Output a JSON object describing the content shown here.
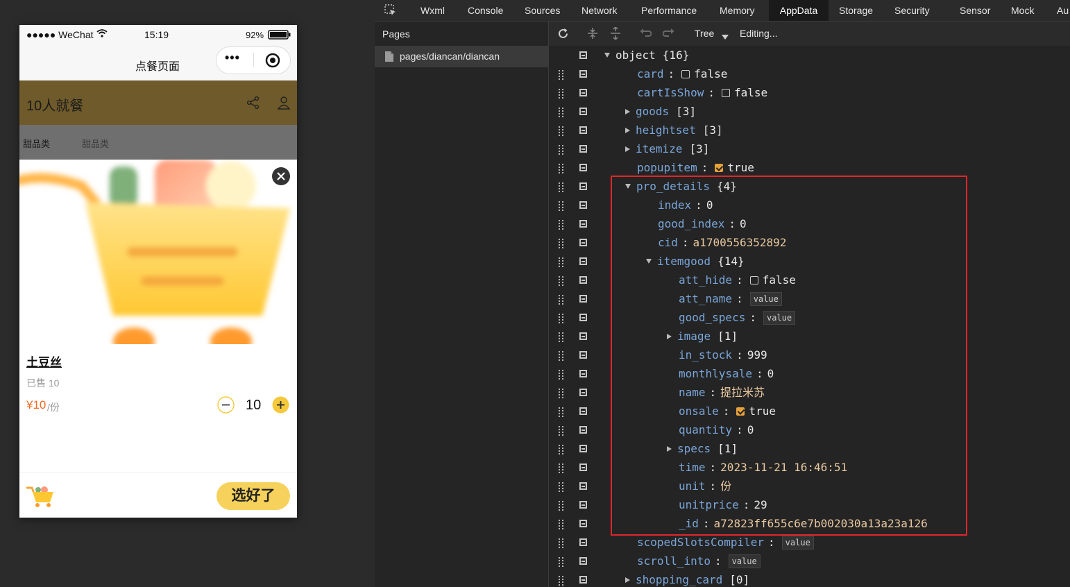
{
  "phone": {
    "status": {
      "carrier": "●●●●● WeChat",
      "time": "15:19",
      "battery": "92%"
    },
    "nav": {
      "title": "点餐页面",
      "more": "•••"
    },
    "shop": {
      "title": "10人就餐"
    },
    "categories": [
      "甜品类",
      "甜品类"
    ],
    "product": {
      "name": "土豆丝",
      "sold": "已售 10",
      "price": "¥10",
      "unit": "/份",
      "quantity": "10"
    },
    "cart": {
      "confirm_label": "选好了"
    }
  },
  "devtools": {
    "tabs": [
      "Wxml",
      "Console",
      "Sources",
      "Network",
      "Performance",
      "Memory",
      "AppData",
      "Storage",
      "Security",
      "Sensor",
      "Mock",
      "Au"
    ],
    "active_tab": "AppData",
    "pages_title": "Pages",
    "page_item": "pages/diancan/diancan",
    "toolbar": {
      "view_mode": "Tree",
      "status": "Editing..."
    },
    "tree": [
      {
        "indent": 0,
        "toggle": "down",
        "key": "object",
        "type": "obj",
        "count": "{16}"
      },
      {
        "indent": 1,
        "key": "card",
        "type": "bool",
        "value": "false",
        "checked": false
      },
      {
        "indent": 1,
        "key": "cartIsShow",
        "type": "bool",
        "value": "false",
        "checked": false
      },
      {
        "indent": 1,
        "toggle": "right",
        "key": "goods",
        "type": "obj",
        "count": "[3]"
      },
      {
        "indent": 1,
        "toggle": "right",
        "key": "heightset",
        "type": "obj",
        "count": "[3]"
      },
      {
        "indent": 1,
        "toggle": "right",
        "key": "itemize",
        "type": "obj",
        "count": "[3]"
      },
      {
        "indent": 1,
        "key": "popupitem",
        "type": "bool",
        "value": "true",
        "checked": true
      },
      {
        "indent": 1,
        "toggle": "down",
        "key": "pro_details",
        "type": "obj",
        "count": "{4}"
      },
      {
        "indent": 2,
        "key": "index",
        "type": "num",
        "value": "0"
      },
      {
        "indent": 2,
        "key": "good_index",
        "type": "num",
        "value": "0"
      },
      {
        "indent": 2,
        "key": "cid",
        "type": "str",
        "value": "a1700556352892"
      },
      {
        "indent": 2,
        "toggle": "down",
        "key": "itemgood",
        "type": "obj",
        "count": "{14}"
      },
      {
        "indent": 3,
        "key": "att_hide",
        "type": "bool",
        "value": "false",
        "checked": false
      },
      {
        "indent": 3,
        "key": "att_name",
        "type": "tag",
        "value": "value"
      },
      {
        "indent": 3,
        "key": "good_specs",
        "type": "tag",
        "value": "value"
      },
      {
        "indent": 3,
        "toggle": "right",
        "key": "image",
        "type": "obj",
        "count": "[1]"
      },
      {
        "indent": 3,
        "key": "in_stock",
        "type": "num",
        "value": "999"
      },
      {
        "indent": 3,
        "key": "monthlysale",
        "type": "num",
        "value": "0"
      },
      {
        "indent": 3,
        "key": "name",
        "type": "str",
        "value": "提拉米苏"
      },
      {
        "indent": 3,
        "key": "onsale",
        "type": "bool",
        "value": "true",
        "checked": true
      },
      {
        "indent": 3,
        "key": "quantity",
        "type": "num",
        "value": "0"
      },
      {
        "indent": 3,
        "toggle": "right",
        "key": "specs",
        "type": "obj",
        "count": "[1]"
      },
      {
        "indent": 3,
        "key": "time",
        "type": "str",
        "value": "2023-11-21 16:46:51"
      },
      {
        "indent": 3,
        "key": "unit",
        "type": "str",
        "value": "份"
      },
      {
        "indent": 3,
        "key": "unitprice",
        "type": "num",
        "value": "29"
      },
      {
        "indent": 3,
        "key": "_id",
        "type": "str",
        "value": "a72823ff655c6e7b002030a13a23a126"
      },
      {
        "indent": 1,
        "key": "scopedSlotsCompiler",
        "type": "tag",
        "value": "value"
      },
      {
        "indent": 1,
        "key": "scroll_into",
        "type": "tag",
        "value": "value"
      },
      {
        "indent": 1,
        "toggle": "right",
        "key": "shopping_card",
        "type": "obj",
        "count": "[0]"
      }
    ]
  }
}
